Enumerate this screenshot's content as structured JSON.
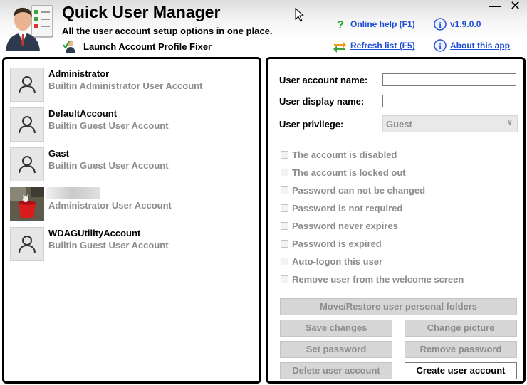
{
  "header": {
    "title": "Quick User Manager",
    "subtitle": "All the user account setup options in one place.",
    "launch_fixer": "Launch Account Profile Fixer",
    "online_help": "Online help (F1)",
    "version": "v1.9.0.0",
    "refresh": "Refresh list (F5)",
    "about": "About this app",
    "minimize": "—",
    "close": "✕"
  },
  "users": [
    {
      "name": "Administrator",
      "description": "Builtin Administrator User Account"
    },
    {
      "name": "DefaultAccount",
      "description": "Builtin Guest User Account"
    },
    {
      "name": "Gast",
      "description": "Builtin Guest User Account"
    },
    {
      "name": "",
      "description": "Administrator User Account"
    },
    {
      "name": "WDAGUtilityAccount",
      "description": "Builtin Guest User Account"
    }
  ],
  "form": {
    "account_name_label": "User account name:",
    "account_name_value": "",
    "display_name_label": "User display name:",
    "display_name_value": "",
    "privilege_label": "User privilege:",
    "privilege_value": "Guest",
    "options": [
      "The account is disabled",
      "The account is locked out",
      "Password can not be changed",
      "Password is not required",
      "Password never expires",
      "Password is expired",
      "Auto-logon this user",
      "Remove user from the welcome screen"
    ]
  },
  "buttons": {
    "move_restore": "Move/Restore user personal folders",
    "save_changes": "Save changes",
    "change_picture": "Change picture",
    "set_password": "Set password",
    "remove_password": "Remove password",
    "delete_account": "Delete user account",
    "create_account": "Create user account"
  },
  "colors": {
    "link": "#1e4fd6",
    "disabled_text": "#8c8c8c",
    "panel_border": "#000000",
    "help_icon": "#2ea52e",
    "info_icon": "#2a52c9"
  }
}
